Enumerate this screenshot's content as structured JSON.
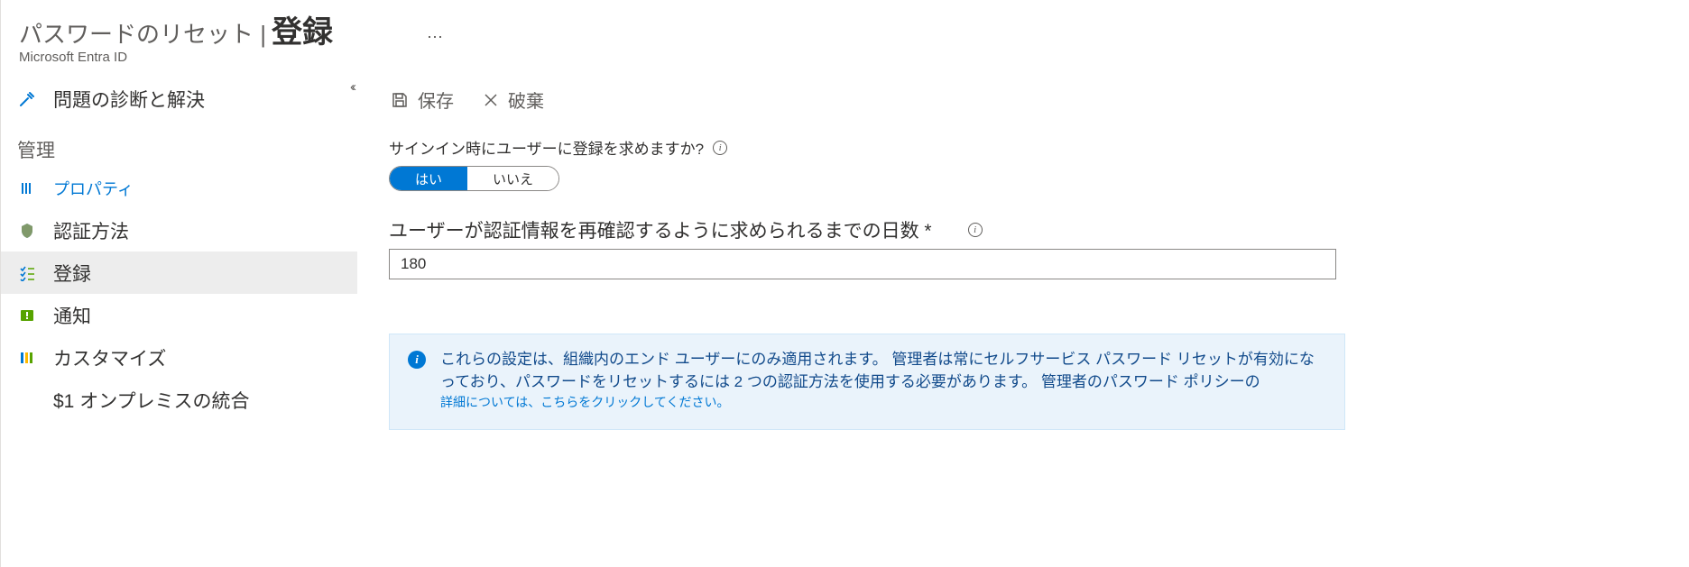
{
  "header": {
    "title_prefix": "パスワードのリセット |",
    "title_main": "登録",
    "ellipsis": "⋯",
    "subtitle": "Microsoft Entra ID"
  },
  "sidebar": {
    "diagnose_label": "問題の診断と解決",
    "manage_group_label": "管理",
    "items": {
      "properties": "プロパティ",
      "auth_methods": "認証方法",
      "registration": "登録",
      "notifications": "通知",
      "customize": "カスタマイズ",
      "onprem": "$1 オンプレミスの統合"
    }
  },
  "toolbar": {
    "save": "保存",
    "discard": "破棄"
  },
  "settings": {
    "require_register_label": "サインイン時にユーザーに登録を求めますか?",
    "yes": "はい",
    "no": "いいえ",
    "days_label": "ユーザーが認証情報を再確認するように求められるまでの日数 *",
    "days_value": "180"
  },
  "banner": {
    "main": "これらの設定は、組織内のエンド ユーザーにのみ適用されます。 管理者は常にセルフサービス パスワード リセットが有効になっており、パスワードをリセットするには 2 つの認証方法を使用する必要があります。 管理者のパスワード ポリシーの",
    "link": "詳細については、こちらをクリックしてください。"
  }
}
